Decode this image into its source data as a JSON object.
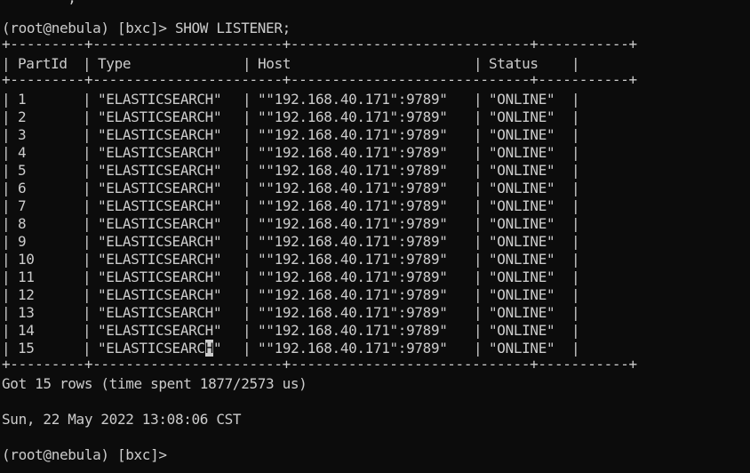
{
  "terminal": {
    "partial_top_line": "        ,",
    "command_line": "(root@nebula) [bxc]> SHOW LISTENER;",
    "border_top": "+---------+-----------------------+-----------------------------+-----------+",
    "header": {
      "col1": "PartId",
      "col2": "Type",
      "col3": "Host",
      "col4": "Status"
    },
    "border_mid": "+---------+-----------------------+-----------------------------+-----------+",
    "rows": [
      {
        "part": "1",
        "type": "\"ELASTICSEARCH\"",
        "host": "\"\"192.168.40.171\":9789\"",
        "status": "\"ONLINE\""
      },
      {
        "part": "2",
        "type": "\"ELASTICSEARCH\"",
        "host": "\"\"192.168.40.171\":9789\"",
        "status": "\"ONLINE\""
      },
      {
        "part": "3",
        "type": "\"ELASTICSEARCH\"",
        "host": "\"\"192.168.40.171\":9789\"",
        "status": "\"ONLINE\""
      },
      {
        "part": "4",
        "type": "\"ELASTICSEARCH\"",
        "host": "\"\"192.168.40.171\":9789\"",
        "status": "\"ONLINE\""
      },
      {
        "part": "5",
        "type": "\"ELASTICSEARCH\"",
        "host": "\"\"192.168.40.171\":9789\"",
        "status": "\"ONLINE\""
      },
      {
        "part": "6",
        "type": "\"ELASTICSEARCH\"",
        "host": "\"\"192.168.40.171\":9789\"",
        "status": "\"ONLINE\""
      },
      {
        "part": "7",
        "type": "\"ELASTICSEARCH\"",
        "host": "\"\"192.168.40.171\":9789\"",
        "status": "\"ONLINE\""
      },
      {
        "part": "8",
        "type": "\"ELASTICSEARCH\"",
        "host": "\"\"192.168.40.171\":9789\"",
        "status": "\"ONLINE\""
      },
      {
        "part": "9",
        "type": "\"ELASTICSEARCH\"",
        "host": "\"\"192.168.40.171\":9789\"",
        "status": "\"ONLINE\""
      },
      {
        "part": "10",
        "type": "\"ELASTICSEARCH\"",
        "host": "\"\"192.168.40.171\":9789\"",
        "status": "\"ONLINE\""
      },
      {
        "part": "11",
        "type": "\"ELASTICSEARCH\"",
        "host": "\"\"192.168.40.171\":9789\"",
        "status": "\"ONLINE\""
      },
      {
        "part": "12",
        "type": "\"ELASTICSEARCH\"",
        "host": "\"\"192.168.40.171\":9789\"",
        "status": "\"ONLINE\""
      },
      {
        "part": "13",
        "type": "\"ELASTICSEARCH\"",
        "host": "\"\"192.168.40.171\":9789\"",
        "status": "\"ONLINE\""
      },
      {
        "part": "14",
        "type": "\"ELASTICSEARCH\"",
        "host": "\"\"192.168.40.171\":9789\"",
        "status": "\"ONLINE\""
      },
      {
        "part": "15",
        "type_before_cursor": "\"ELASTICSEARC",
        "type_cursor_char": "H",
        "type_after_cursor": "\"",
        "host": "\"\"192.168.40.171\":9789\"",
        "status": "\"ONLINE\""
      }
    ],
    "border_bottom": "+---------+-----------------------+-----------------------------+-----------+",
    "summary": "Got 15 rows (time spent 1877/2573 us)",
    "timestamp": "Sun, 22 May 2022 13:08:06 CST",
    "prompt": "(root@nebula) [bxc]>"
  },
  "colors": {
    "background": "#0c0c0c",
    "foreground": "#cccccc"
  }
}
